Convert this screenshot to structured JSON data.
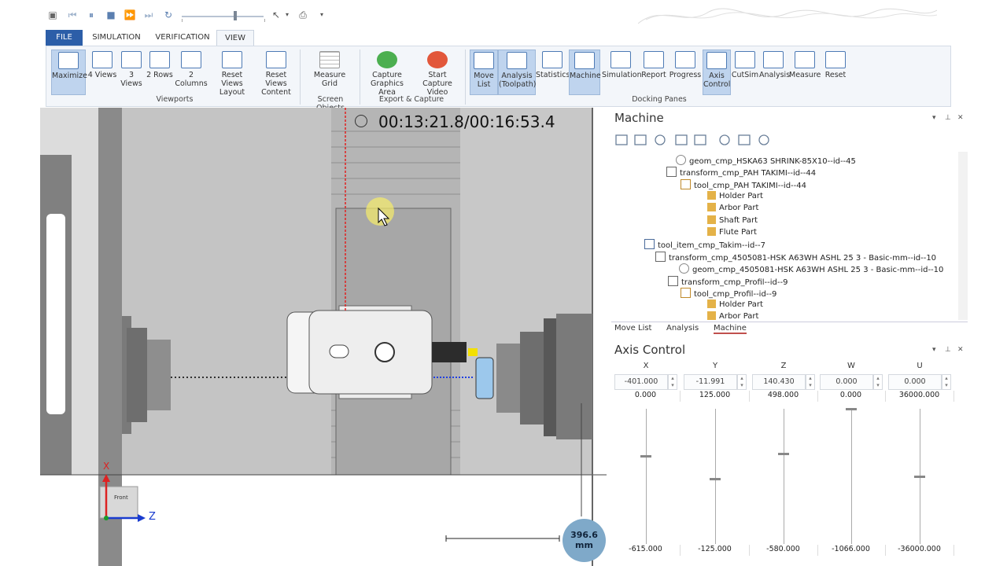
{
  "ribbon_tabs": [
    {
      "label": "FILE"
    },
    {
      "label": "SIMULATION"
    },
    {
      "label": "VERIFICATION"
    },
    {
      "label": "VIEW"
    }
  ],
  "ribbon": {
    "viewports": {
      "label": "Viewports",
      "buttons": [
        "Maximize",
        "4 Views",
        "3 Views",
        "2 Rows",
        "2 Columns",
        "Reset Views Layout",
        "Reset Views Content"
      ]
    },
    "screen_objects": {
      "label": "Screen Objects",
      "buttons": [
        "Measure Grid"
      ]
    },
    "export_capture": {
      "label": "Export & Capture",
      "buttons": [
        "Capture Graphics Area",
        "Start Capture Video"
      ]
    },
    "docking_panes": {
      "label": "Docking Panes",
      "buttons": [
        "Move List",
        "Analysis (Toolpath)",
        "Statistics",
        "Machine",
        "Simulation",
        "Report",
        "Progress",
        "Axis Control",
        "CutSim",
        "Analysis",
        "Measure",
        "Reset"
      ]
    }
  },
  "viewport": {
    "timer": "00:13:21.8/00:16:53.4",
    "axis_x": "X",
    "axis_z": "Z",
    "view_cube": "Front",
    "measurement_value": "396.6",
    "measurement_unit": "mm"
  },
  "machine_pane": {
    "title": "Machine",
    "tree": [
      {
        "label": "geom_cmp_HSKA63 SHRINK-85X10--id--45"
      },
      {
        "label": "transform_cmp_PAH TAKIMI--id--44"
      },
      {
        "label": "tool_cmp_PAH TAKIMI--id--44"
      },
      {
        "label": "Holder Part"
      },
      {
        "label": "Arbor Part"
      },
      {
        "label": "Shaft Part"
      },
      {
        "label": "Flute Part"
      },
      {
        "label": "tool_item_cmp_Takim--id--7"
      },
      {
        "label": "transform_cmp_4505081-HSK A63WH ASHL 25 3 - Basic-mm--id--10"
      },
      {
        "label": "geom_cmp_4505081-HSK A63WH ASHL 25 3 - Basic-mm--id--10"
      },
      {
        "label": "transform_cmp_Profil--id--9"
      },
      {
        "label": "tool_cmp_Profil--id--9"
      },
      {
        "label": "Holder Part"
      },
      {
        "label": "Arbor Part"
      }
    ],
    "bottom_tabs": [
      "Move List",
      "Analysis",
      "Machine"
    ]
  },
  "axis_pane": {
    "title": "Axis Control",
    "axes": [
      {
        "name": "X",
        "value": "-401.000",
        "max": "0.000",
        "min": "-615.000",
        "level": 0.65
      },
      {
        "name": "Y",
        "value": "-11.991",
        "max": "125.000",
        "min": "-125.000",
        "level": 0.48
      },
      {
        "name": "Z",
        "value": "140.430",
        "max": "498.000",
        "min": "-580.000",
        "level": 0.67
      },
      {
        "name": "W",
        "value": "0.000",
        "max": "0.000",
        "min": "-1066.000",
        "level": 1.0
      },
      {
        "name": "U",
        "value": "0.000",
        "max": "36000.000",
        "min": "-36000.000",
        "level": 0.5
      }
    ]
  },
  "colors": {
    "file_tab": "#2c5ea8",
    "selected_button": "#bfd4ee",
    "toolpath_red": "#e02020",
    "toolpath_blue": "#2040e0",
    "measure_bubble": "#7fa9c9"
  }
}
